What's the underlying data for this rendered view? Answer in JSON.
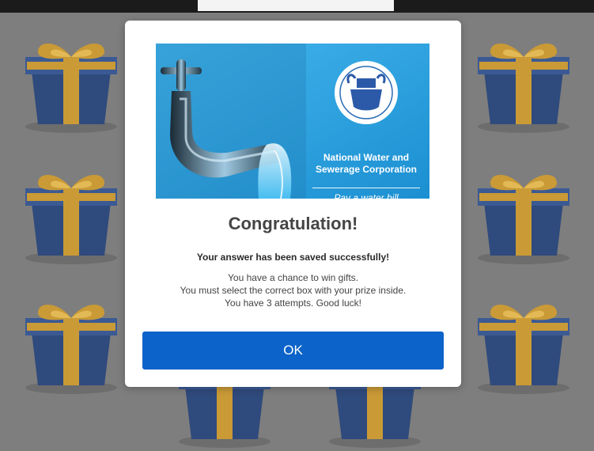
{
  "modal": {
    "banner": {
      "org_name_line1": "National Water and",
      "org_name_line2": "Sewerage Corporation",
      "tagline": "Pay a water bill"
    },
    "title": "Congratulation!",
    "saved_message": "Your answer has been saved successfully!",
    "body_lines": [
      "You have a chance to win gifts.",
      "You must select the correct box with your prize inside.",
      "You have 3 attempts. Good luck!"
    ],
    "ok_label": "OK"
  },
  "background": {
    "icon": "gift-box-icon",
    "colors": {
      "box": "#2f4a7c",
      "ribbon": "#c99a36",
      "backdrop": "#7e7e7e"
    }
  },
  "colors": {
    "accent": "#0c63c9",
    "banner": "#27a3de"
  }
}
